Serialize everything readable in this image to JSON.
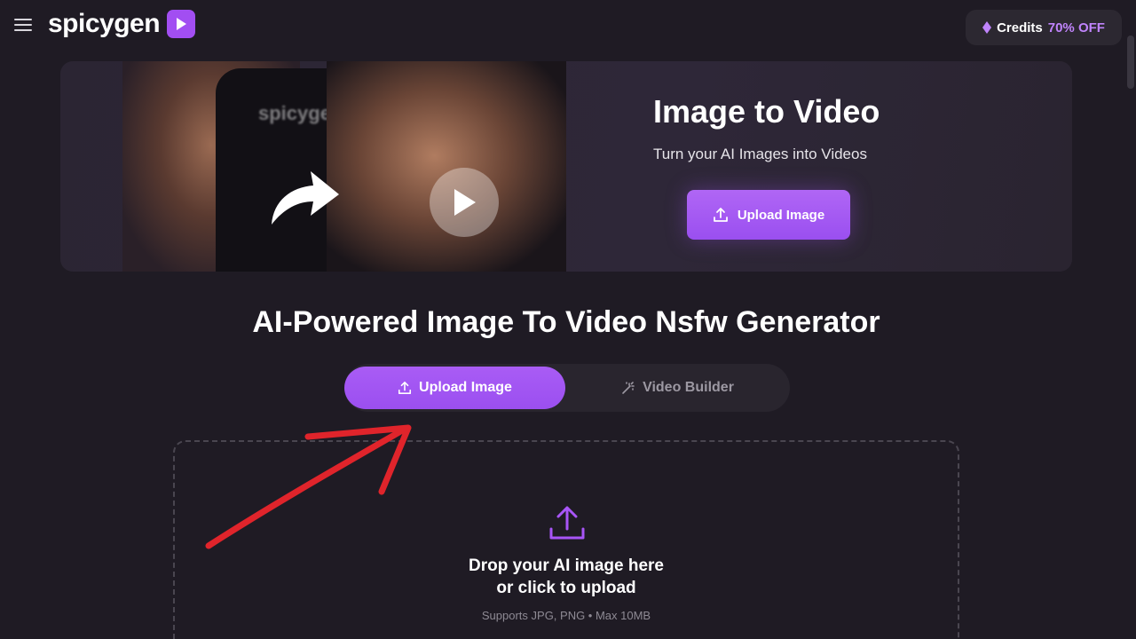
{
  "header": {
    "brand": "spicygen",
    "credits_label": "Credits",
    "credits_discount": "70% OFF"
  },
  "banner": {
    "hero_brand": "spicygen",
    "title": "Image to Video",
    "subtitle": "Turn your AI Images into Videos",
    "upload_label": "Upload Image"
  },
  "main": {
    "title": "AI-Powered Image To Video Nsfw Generator",
    "tabs": [
      {
        "label": "Upload Image",
        "active": true
      },
      {
        "label": "Video Builder",
        "active": false
      }
    ],
    "dropzone": {
      "line1": "Drop your AI image here",
      "line2": "or click to upload",
      "support": "Supports JPG, PNG • Max 10MB"
    }
  },
  "colors": {
    "accent": "#a24ef2",
    "background": "#1f1b24",
    "annotation": "#e0242b"
  }
}
